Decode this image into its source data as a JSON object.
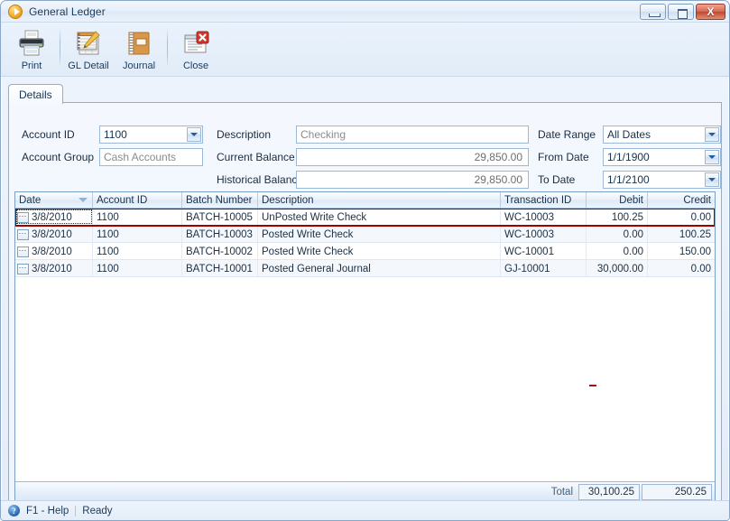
{
  "window": {
    "title": "General Ledger",
    "app_icon": "play-circle-icon",
    "minimize_label": "Minimize",
    "maximize_label": "Maximize",
    "close_label": "X"
  },
  "toolbar": {
    "buttons": [
      {
        "label": "Print",
        "icon": "printer-icon"
      },
      {
        "label": "GL Detail",
        "icon": "ledger-notebook-icon"
      },
      {
        "label": "Journal",
        "icon": "journal-book-icon"
      },
      {
        "label": "Close",
        "icon": "close-window-icon"
      }
    ]
  },
  "tabs": [
    {
      "label": "Details",
      "active": true
    }
  ],
  "form": {
    "account_id": {
      "label": "Account ID",
      "value": "1100",
      "type": "combobox"
    },
    "account_group": {
      "label": "Account Group",
      "value": "Cash Accounts",
      "readonly": true
    },
    "description": {
      "label": "Description",
      "value": "Checking",
      "readonly": true
    },
    "current_balance": {
      "label": "Current Balance",
      "value": "29,850.00",
      "readonly": true
    },
    "historical_balance": {
      "label": "Historical Balance",
      "value": "29,850.00",
      "readonly": true
    },
    "date_range": {
      "label": "Date Range",
      "value": "All Dates",
      "type": "combobox"
    },
    "from_date": {
      "label": "From Date",
      "value": "1/1/1900",
      "type": "combobox"
    },
    "to_date": {
      "label": "To Date",
      "value": "1/1/2100",
      "type": "combobox"
    }
  },
  "grid": {
    "columns": [
      {
        "key": "date",
        "label": "Date",
        "align": "left",
        "sorted": true
      },
      {
        "key": "account_id",
        "label": "Account ID",
        "align": "left"
      },
      {
        "key": "batch_number",
        "label": "Batch Number",
        "align": "left"
      },
      {
        "key": "description",
        "label": "Description",
        "align": "left"
      },
      {
        "key": "transaction_id",
        "label": "Transaction ID",
        "align": "left"
      },
      {
        "key": "debit",
        "label": "Debit",
        "align": "right"
      },
      {
        "key": "credit",
        "label": "Credit",
        "align": "right"
      }
    ],
    "rows": [
      {
        "date": "3/8/2010",
        "account_id": "1100",
        "batch_number": "BATCH-10005",
        "description": "UnPosted Write Check",
        "transaction_id": "WC-10003",
        "debit": "100.25",
        "credit": "0.00",
        "selected": true
      },
      {
        "date": "3/8/2010",
        "account_id": "1100",
        "batch_number": "BATCH-10003",
        "description": "Posted Write Check",
        "transaction_id": "WC-10003",
        "debit": "0.00",
        "credit": "100.25",
        "selected": false
      },
      {
        "date": "3/8/2010",
        "account_id": "1100",
        "batch_number": "BATCH-10002",
        "description": "Posted Write Check",
        "transaction_id": "WC-10001",
        "debit": "0.00",
        "credit": "150.00",
        "selected": false
      },
      {
        "date": "3/8/2010",
        "account_id": "1100",
        "batch_number": "BATCH-10001",
        "description": "Posted General Journal",
        "transaction_id": "GJ-10001",
        "debit": "30,000.00",
        "credit": "0.00",
        "selected": false
      }
    ],
    "row_expand_icon": "ellipsis-button-icon",
    "totals": {
      "label": "Total",
      "debit": "30,100.25",
      "credit": "250.25"
    }
  },
  "statusbar": {
    "help_icon": "question-mark-icon",
    "help_text": "F1 - Help",
    "status_text": "Ready"
  },
  "colors": {
    "selection_outline": "#a00000",
    "accent_blue": "#1e5fa8",
    "window_chrome": "#e3edf9"
  }
}
